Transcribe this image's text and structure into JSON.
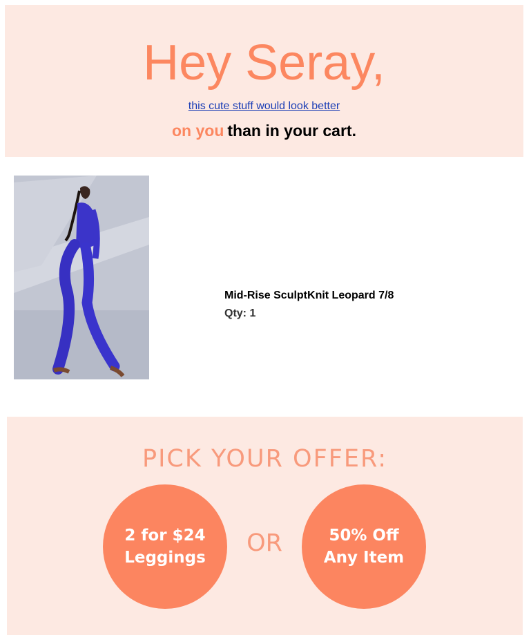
{
  "hero": {
    "greeting": "Hey Seray,",
    "line1_link": "this cute stuff would look better",
    "line2_accent": "on you",
    "line2_rest": "than in your cart."
  },
  "cart_item": {
    "name": "Mid-Rise SculptKnit Leopard 7/8",
    "qty": "Qty: 1",
    "image_icon": "product-photo"
  },
  "offer": {
    "title": "PICK YOUR OFFER:",
    "option_1": "2 for $24\nLeggings",
    "separator": "OR",
    "option_2": "50% Off\nAny Item"
  },
  "colors": {
    "accent": "#fc8760",
    "panel": "#fde9e2",
    "link": "#1a3db5"
  }
}
